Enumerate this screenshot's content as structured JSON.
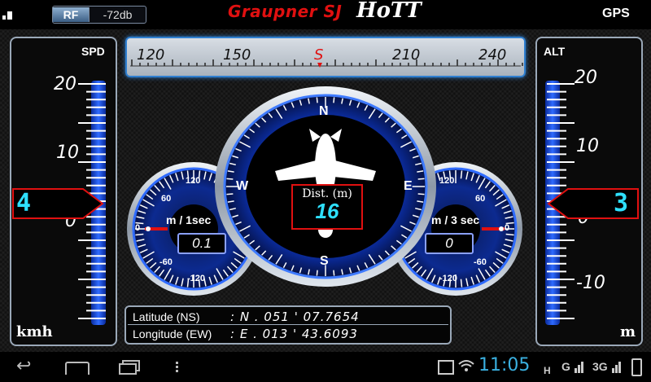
{
  "header": {
    "rf_label": "RF",
    "rf_value": "-72db",
    "brand": "Graupner SJ",
    "brand_product": "HoTT",
    "mode": "GPS"
  },
  "speed_panel": {
    "title": "SPD",
    "scale": [
      "20",
      "10",
      "0"
    ],
    "current": "4",
    "unit": "kmh"
  },
  "altitude_panel": {
    "title": "ALT",
    "scale": [
      "20",
      "10",
      "0",
      "-10"
    ],
    "current": "3",
    "unit": "m"
  },
  "heading_strip": {
    "ticks": [
      "120",
      "150",
      "S",
      "210",
      "240"
    ]
  },
  "compass": {
    "north": "N",
    "south": "S",
    "east": "E",
    "west": "W",
    "distance_label": "Dist. (m)",
    "distance_value": "16"
  },
  "left_gauge": {
    "unit": "m / 1sec",
    "value": "0.1",
    "ticks": [
      "120",
      "60",
      "0",
      "-60",
      "-120"
    ]
  },
  "right_gauge": {
    "unit": "m / 3 sec",
    "value": "0",
    "ticks": [
      "120",
      "60",
      "0",
      "-60",
      "-120"
    ]
  },
  "coordinates": {
    "lat_label": "Latitude (NS)",
    "lat_value": ": N . 051 ' 07.7654",
    "lon_label": "Longitude (EW)",
    "lon_value": ": E . 013 ' 43.6093"
  },
  "statusbar": {
    "time": "11:05",
    "net_h": "H",
    "net_g": "G",
    "net_3g": "3G"
  },
  "colors": {
    "accent_blue": "#2f6bff",
    "readout_cyan": "#2ee0ff",
    "pointer_red": "#e01010"
  }
}
